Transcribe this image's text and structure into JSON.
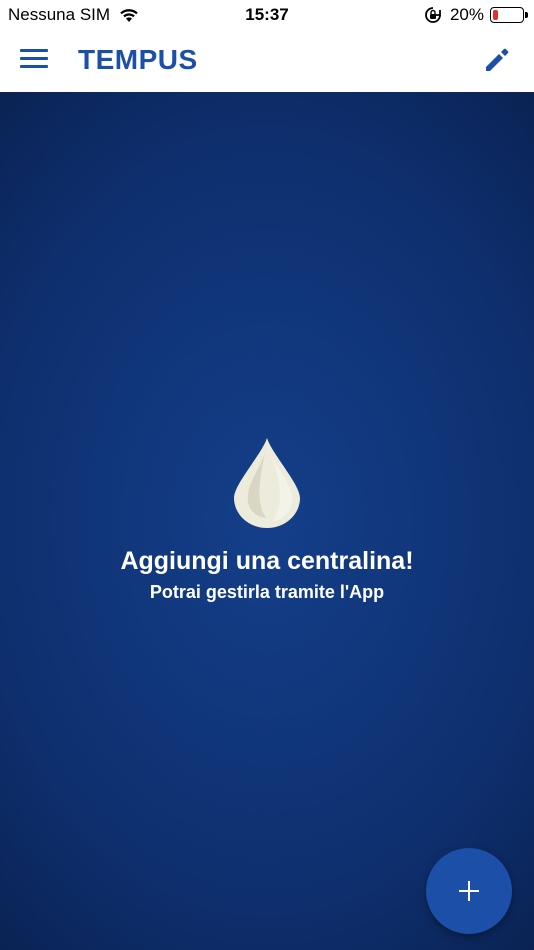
{
  "status_bar": {
    "carrier": "Nessuna SIM",
    "time": "15:37",
    "battery_pct": "20%",
    "battery_level": 0.2,
    "icons": [
      "wifi-icon",
      "rotation-lock-icon",
      "battery-icon"
    ]
  },
  "app_bar": {
    "title": "TEMPUS",
    "left_icon": "menu-icon",
    "right_icon": "edit-pencil-icon"
  },
  "empty_state": {
    "icon": "water-drop-icon",
    "title": "Aggiungi una centralina!",
    "subtitle": "Potrai gestirla tramite l'App"
  },
  "fab": {
    "icon": "plus-icon"
  },
  "colors": {
    "brand_blue": "#1b4fa8",
    "background_center": "#143f8a",
    "background_edge": "#071a40",
    "drop": "#ecebdc",
    "battery_low": "#e03030"
  }
}
